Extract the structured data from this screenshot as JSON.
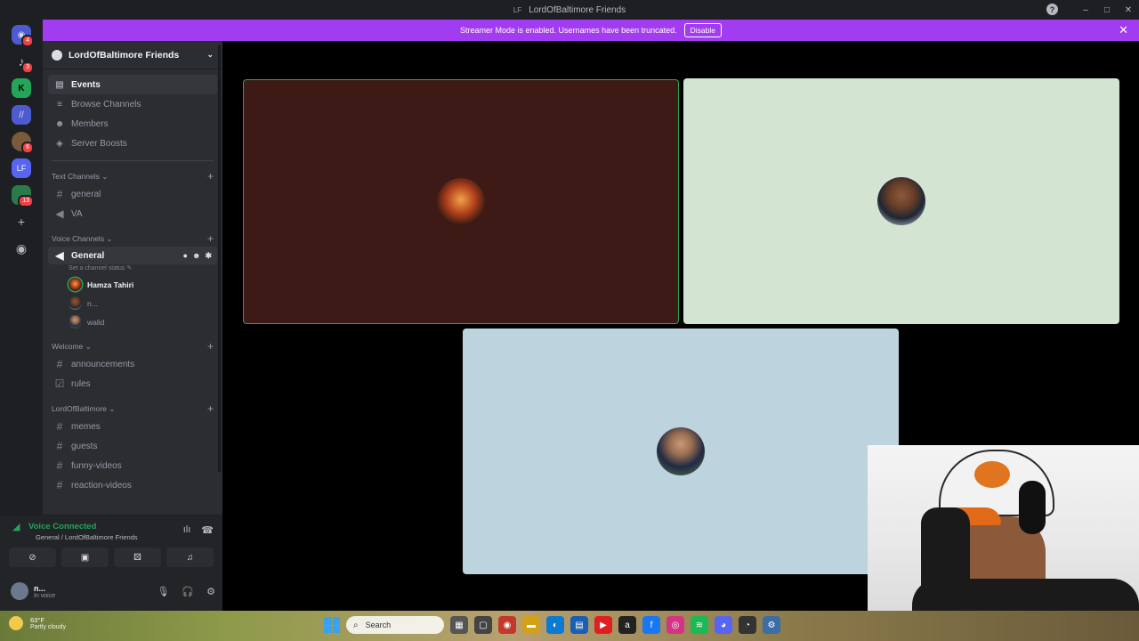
{
  "window": {
    "title_badge": "LF",
    "title": "LordOfBaltimore Friends",
    "help": "?",
    "minimize": "–",
    "maximize": "□",
    "close": "✕"
  },
  "banner": {
    "text": "Streamer Mode is enabled. Usernames have been truncated.",
    "disable_label": "Disable",
    "close": "✕"
  },
  "guilds": [
    {
      "icon": "discord-home-icon",
      "badge": "4"
    },
    {
      "icon": "bell-icon",
      "badge": "3"
    },
    {
      "icon": "kick-server-icon",
      "badge": ""
    },
    {
      "icon": "slash-server-icon",
      "badge": ""
    },
    {
      "icon": "photo-server-icon",
      "badge": "6"
    },
    {
      "icon": "lf-server-icon",
      "label": "LF",
      "badge": ""
    },
    {
      "icon": "folder-server-icon",
      "badge": "13"
    },
    {
      "icon": "add-server-icon",
      "label": "+"
    },
    {
      "icon": "explore-icon",
      "label": "◉"
    }
  ],
  "server": {
    "name": "LordOfBaltimore Friends",
    "chevron": "⌄"
  },
  "nav": [
    {
      "label": "Events",
      "icon": "calendar-icon",
      "glyph": "▤",
      "active": true
    },
    {
      "label": "Browse Channels",
      "icon": "browse-channels-icon",
      "glyph": "≡",
      "active": false
    },
    {
      "label": "Members",
      "icon": "members-icon",
      "glyph": "☻",
      "active": false
    },
    {
      "label": "Server Boosts",
      "icon": "boost-icon",
      "glyph": "◈",
      "active": false
    }
  ],
  "categories": {
    "text": {
      "label": "Text Channels ⌄",
      "channels": [
        "general",
        "VA"
      ]
    },
    "voice": {
      "label": "Voice Channels ⌄"
    },
    "welcome": {
      "label": "Welcome ⌄",
      "channels": [
        "announcements",
        "rules"
      ]
    },
    "lob": {
      "label": "LordOfBaltimore ⌄",
      "channels": [
        "memes",
        "guests",
        "funny-videos",
        "reaction-videos"
      ]
    }
  },
  "voice_channel": {
    "name": "General",
    "status": "Set a channel status ✎",
    "users": [
      {
        "name": "Hamza Tahiri",
        "speaking": true
      },
      {
        "name": "n...",
        "speaking": false
      },
      {
        "name": "walid",
        "speaking": false
      }
    ]
  },
  "voice_panel": {
    "title": "Voice Connected",
    "subtitle": "General / LordOfBaltimore Friends"
  },
  "user": {
    "name": "n...",
    "status": "In voice"
  },
  "taskbar": {
    "temp": "63°F",
    "condition": "Partly cloudy",
    "search": "Search"
  },
  "colors": {
    "accent": "#a23cf0",
    "voice_green": "#23a55a",
    "tile1": "#3d1a16",
    "tile2": "#d4e4d2",
    "tile3": "#bdd3de"
  }
}
